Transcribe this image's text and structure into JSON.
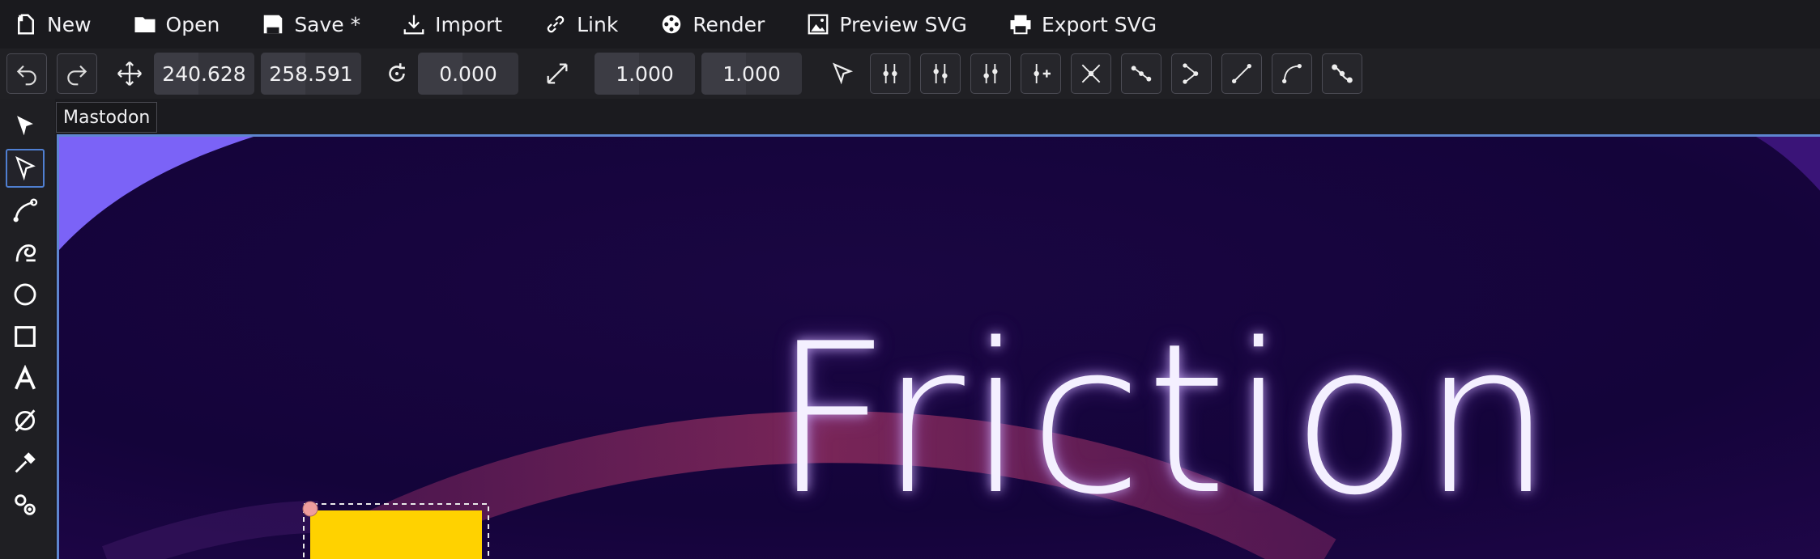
{
  "menu": {
    "items": [
      {
        "id": "new",
        "label": "New",
        "icon": "new-file-icon"
      },
      {
        "id": "open",
        "label": "Open",
        "icon": "folder-icon"
      },
      {
        "id": "save",
        "label": "Save *",
        "icon": "floppy-disk-icon"
      },
      {
        "id": "import",
        "label": "Import",
        "icon": "download-icon"
      },
      {
        "id": "link",
        "label": "Link",
        "icon": "link-icon"
      },
      {
        "id": "render",
        "label": "Render",
        "icon": "film-reel-icon"
      },
      {
        "id": "preview_svg",
        "label": "Preview SVG",
        "icon": "image-icon"
      },
      {
        "id": "export_svg",
        "label": "Export SVG",
        "icon": "printer-icon"
      }
    ]
  },
  "toolbar": {
    "translate_x": "240.628",
    "translate_y": "258.591",
    "rotation": "0.000",
    "scale_x": "1.000",
    "scale_y": "1.000"
  },
  "tooltip": {
    "text": "Mastodon"
  },
  "canvas": {
    "title_text": "Friction",
    "colors": {
      "background": "#0f0530",
      "corner_shape": "#7b63f7",
      "arc": "#7a2a5a",
      "rect": "#ffd200",
      "handle": "#ee9d9d",
      "text": "#f4f0ff"
    }
  },
  "colors": {
    "menubar": "#1a1a1e",
    "toolbar": "#202024",
    "selection_border": "#5e86d0",
    "active_tool": "#4f7fd1"
  }
}
